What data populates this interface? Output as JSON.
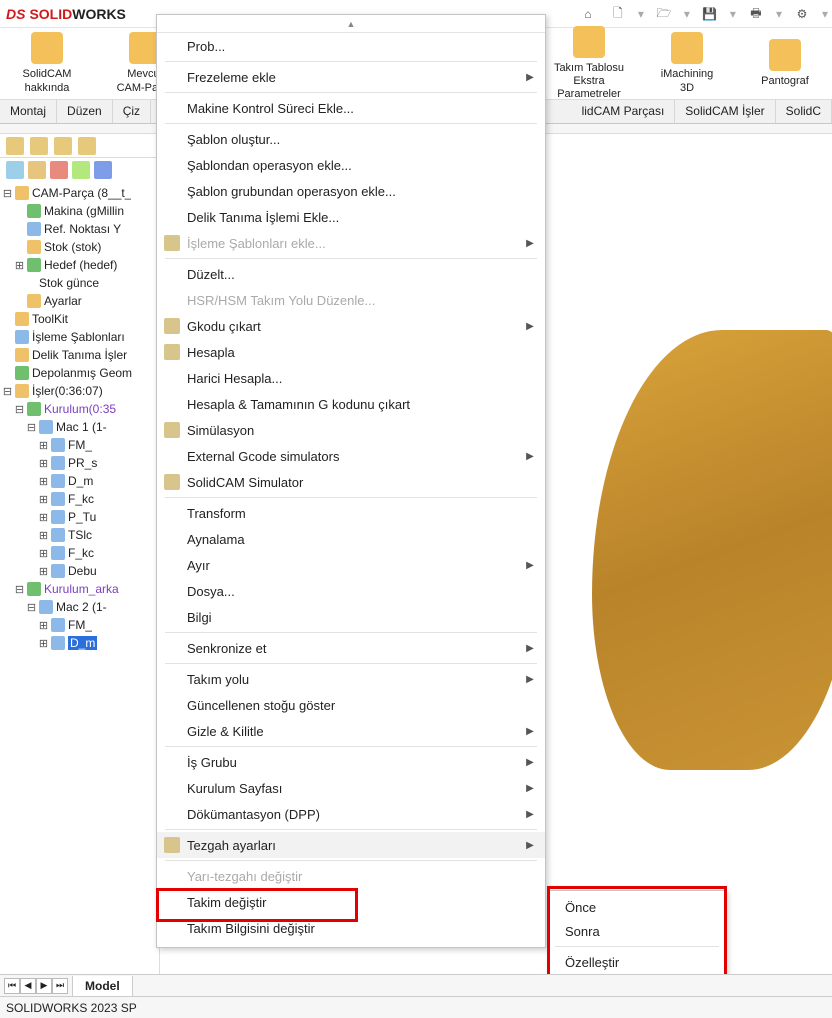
{
  "app": {
    "vendor": "DS",
    "product1": "SOLID",
    "product2": "WORKS"
  },
  "ribbon_btns": [
    {
      "label": "SolidCAM\nhakkında"
    },
    {
      "label": "Mevcut\nCAM-Parça"
    }
  ],
  "ribbon_btns_right": [
    {
      "label": "Takım Tablosu Ekstra\nParametreler"
    },
    {
      "label": "iMachining\n3D"
    },
    {
      "label": "Pantograf"
    }
  ],
  "tabs_left": [
    "Montaj",
    "Düzen",
    "Çiz"
  ],
  "tabs_right": [
    "lidCAM Parçası",
    "SolidCAM İşler",
    "SolidC"
  ],
  "tree": [
    {
      "ind": 0,
      "pm": "⊟",
      "icoCls": "or",
      "txt": "CAM-Parça (8__t_"
    },
    {
      "ind": 1,
      "pm": "",
      "icoCls": "gr",
      "txt": "Makina (gMillin"
    },
    {
      "ind": 1,
      "pm": "",
      "icoCls": "blue",
      "txt": "Ref. Noktası Y"
    },
    {
      "ind": 1,
      "pm": "",
      "icoCls": "or",
      "txt": "Stok (stok)"
    },
    {
      "ind": 1,
      "pm": "⊞",
      "icoCls": "gr",
      "txt": "Hedef (hedef)"
    },
    {
      "ind": 2,
      "pm": "",
      "icoCls": "",
      "txt": "Stok günce"
    },
    {
      "ind": 1,
      "pm": "",
      "icoCls": "or",
      "txt": "Ayarlar"
    },
    {
      "ind": 0,
      "pm": "",
      "icoCls": "or",
      "txt": "ToolKit"
    },
    {
      "ind": 0,
      "pm": "",
      "icoCls": "blue",
      "txt": "İşleme Şablonları"
    },
    {
      "ind": 0,
      "pm": "",
      "icoCls": "or",
      "txt": "Delik Tanıma İşler"
    },
    {
      "ind": 0,
      "pm": "",
      "icoCls": "gr",
      "txt": "Depolanmış Geom"
    },
    {
      "ind": 0,
      "pm": "⊟",
      "icoCls": "or",
      "txt": "İşler(0:36:07)"
    },
    {
      "ind": 1,
      "pm": "⊟",
      "icoCls": "gr",
      "txt": "Kurulum(0:35",
      "cls": "purple"
    },
    {
      "ind": 2,
      "pm": "⊟",
      "icoCls": "blue",
      "txt": "Mac 1 (1-"
    },
    {
      "ind": 3,
      "pm": "⊞",
      "icoCls": "blue",
      "txt": "FM_"
    },
    {
      "ind": 3,
      "pm": "⊞",
      "icoCls": "blue",
      "txt": "PR_s"
    },
    {
      "ind": 3,
      "pm": "⊞",
      "icoCls": "blue",
      "txt": "D_m"
    },
    {
      "ind": 3,
      "pm": "⊞",
      "icoCls": "blue",
      "txt": "F_kc"
    },
    {
      "ind": 3,
      "pm": "⊞",
      "icoCls": "blue",
      "txt": "P_Tu"
    },
    {
      "ind": 3,
      "pm": "⊞",
      "icoCls": "blue",
      "txt": "TSlc"
    },
    {
      "ind": 3,
      "pm": "⊞",
      "icoCls": "blue",
      "txt": "F_kc"
    },
    {
      "ind": 3,
      "pm": "⊞",
      "icoCls": "blue",
      "txt": "Debu"
    },
    {
      "ind": 1,
      "pm": "⊟",
      "icoCls": "gr",
      "txt": "Kurulum_arka",
      "cls": "purple"
    },
    {
      "ind": 2,
      "pm": "⊟",
      "icoCls": "blue",
      "txt": "Mac 2 (1-"
    },
    {
      "ind": 3,
      "pm": "⊞",
      "icoCls": "blue",
      "txt": "FM_"
    },
    {
      "ind": 3,
      "pm": "⊞",
      "icoCls": "blue",
      "txt": "D_m",
      "cls": "sel"
    }
  ],
  "ctx": [
    {
      "t": "row",
      "label": "Prob..."
    },
    {
      "t": "sep"
    },
    {
      "t": "row",
      "label": "Frezeleme ekle",
      "arrow": true
    },
    {
      "t": "sep"
    },
    {
      "t": "row",
      "label": "Makine Kontrol Süreci Ekle..."
    },
    {
      "t": "sep"
    },
    {
      "t": "row",
      "label": "Şablon oluştur..."
    },
    {
      "t": "row",
      "label": "Şablondan operasyon ekle..."
    },
    {
      "t": "row",
      "label": "Şablon grubundan operasyon ekle..."
    },
    {
      "t": "row",
      "label": "Delik Tanıma İşlemi Ekle..."
    },
    {
      "t": "row",
      "label": "İşleme Şablonları ekle...",
      "arrow": true,
      "disabled": true,
      "icon": true
    },
    {
      "t": "sep"
    },
    {
      "t": "row",
      "label": "Düzelt..."
    },
    {
      "t": "row",
      "label": "HSR/HSM Takım Yolu Düzenle...",
      "disabled": true
    },
    {
      "t": "row",
      "label": "Gkodu çıkart",
      "arrow": true,
      "icon": true
    },
    {
      "t": "row",
      "label": "Hesapla",
      "icon": true
    },
    {
      "t": "row",
      "label": "Harici Hesapla..."
    },
    {
      "t": "row",
      "label": "Hesapla & Tamamının G kodunu çıkart"
    },
    {
      "t": "row",
      "label": "Simülasyon",
      "icon": true
    },
    {
      "t": "row",
      "label": "External Gcode simulators",
      "arrow": true
    },
    {
      "t": "row",
      "label": "SolidCAM Simulator",
      "icon": true
    },
    {
      "t": "sep"
    },
    {
      "t": "row",
      "label": "Transform"
    },
    {
      "t": "row",
      "label": "Aynalama"
    },
    {
      "t": "row",
      "label": "Ayır",
      "arrow": true
    },
    {
      "t": "row",
      "label": "Dosya..."
    },
    {
      "t": "row",
      "label": "Bilgi"
    },
    {
      "t": "sep"
    },
    {
      "t": "row",
      "label": "Senkronize et",
      "arrow": true
    },
    {
      "t": "sep"
    },
    {
      "t": "row",
      "label": "Takım yolu",
      "arrow": true
    },
    {
      "t": "row",
      "label": "Güncellenen stoğu göster"
    },
    {
      "t": "row",
      "label": "Gizle  & Kilitle",
      "arrow": true
    },
    {
      "t": "sep"
    },
    {
      "t": "row",
      "label": "İş Grubu",
      "arrow": true
    },
    {
      "t": "row",
      "label": "Kurulum Sayfası",
      "arrow": true
    },
    {
      "t": "row",
      "label": "Dökümantasyon (DPP)",
      "arrow": true
    },
    {
      "t": "sep"
    },
    {
      "t": "row",
      "label": "Tezgah ayarları",
      "arrow": true,
      "icon": true,
      "hl": true
    },
    {
      "t": "sep"
    },
    {
      "t": "row",
      "label": "Yarı-tezgahı değiştir",
      "disabled": true
    },
    {
      "t": "row",
      "label": "Takim değiştir"
    },
    {
      "t": "row",
      "label": "Takım Bilgisini değiştir"
    }
  ],
  "submenu": [
    {
      "label": "Önce"
    },
    {
      "label": "Sonra"
    },
    {
      "sep": true
    },
    {
      "label": "Özelleştir"
    }
  ],
  "bottom": {
    "tab": "Model"
  },
  "status": "SOLIDWORKS 2023 SP"
}
